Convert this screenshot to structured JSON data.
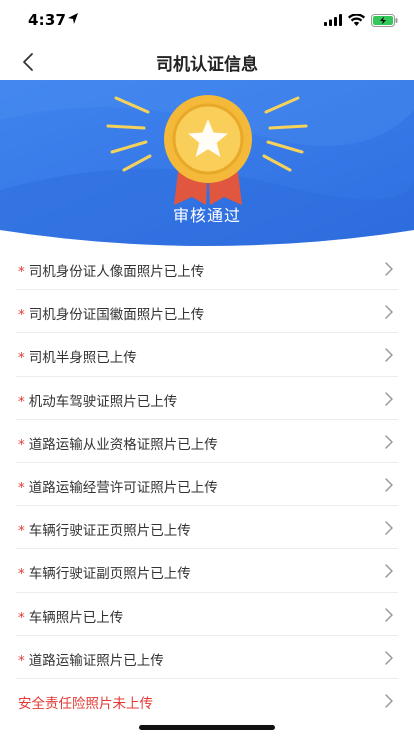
{
  "status_bar": {
    "time": "4:37",
    "icons": [
      "location-arrow-icon",
      "signal-icon",
      "wifi-icon",
      "battery-charging-icon"
    ]
  },
  "nav": {
    "title": "司机认证信息",
    "back_icon": "chevron-left-icon"
  },
  "banner": {
    "status": "审核通过",
    "icon": "medal-star-icon",
    "colors": {
      "banner_blue": "#3a7fea",
      "medal_gold": "#f5b93a",
      "ribbon_red": "#e0563f"
    }
  },
  "items": [
    {
      "required": true,
      "label": "司机身份证人像面照片已上传",
      "status": "uploaded"
    },
    {
      "required": true,
      "label": "司机身份证国徽面照片已上传",
      "status": "uploaded"
    },
    {
      "required": true,
      "label": "司机半身照已上传",
      "status": "uploaded"
    },
    {
      "required": true,
      "label": "机动车驾驶证照片已上传",
      "status": "uploaded"
    },
    {
      "required": true,
      "label": "道路运输从业资格证照片已上传",
      "status": "uploaded"
    },
    {
      "required": true,
      "label": "道路运输经营许可证照片已上传",
      "status": "uploaded"
    },
    {
      "required": true,
      "label": "车辆行驶证正页照片已上传",
      "status": "uploaded"
    },
    {
      "required": true,
      "label": "车辆行驶证副页照片已上传",
      "status": "uploaded"
    },
    {
      "required": true,
      "label": "车辆照片已上传",
      "status": "uploaded"
    },
    {
      "required": true,
      "label": "道路运输证照片已上传",
      "status": "uploaded"
    },
    {
      "required": false,
      "label": "安全责任险照片未上传",
      "status": "missing"
    }
  ],
  "required_marker": "*",
  "colors": {
    "warning_red": "#e53935",
    "divider": "#ececec"
  }
}
